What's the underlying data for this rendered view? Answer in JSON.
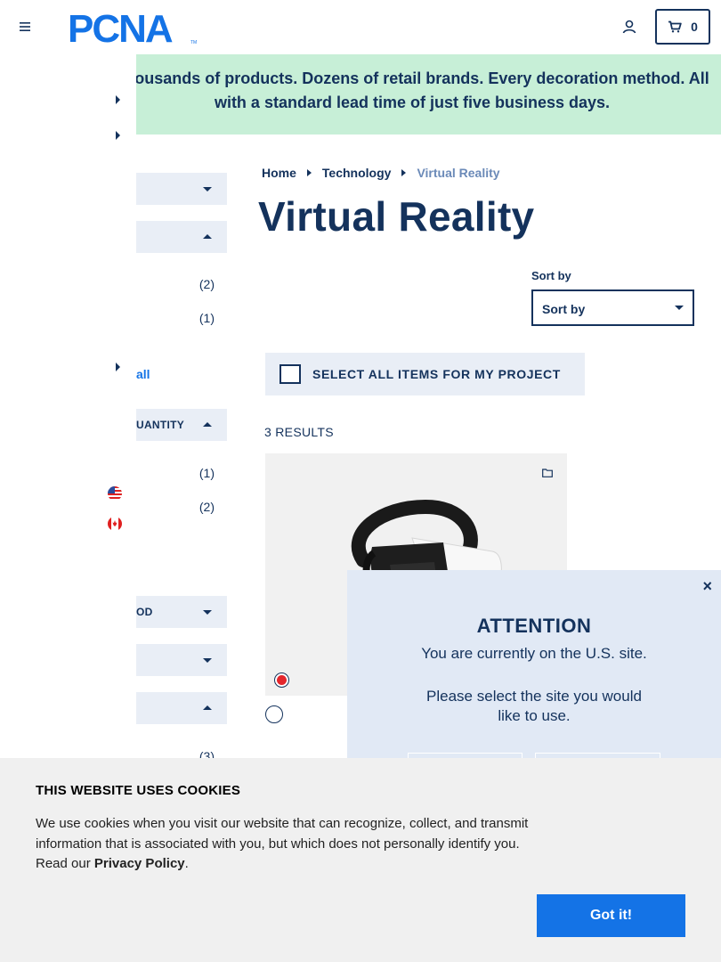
{
  "header": {
    "menu_icon": "hamburger-menu-icon",
    "logo_text": "PCNA",
    "logo_tm": "TM",
    "account_icon": "user-account-icon",
    "cart_icon": "shopping-cart-icon",
    "cart_count": "0"
  },
  "promo": {
    "text": "Thousands of products. Dozens of retail brands. Every decoration method. All with a standard lead time of just five business days."
  },
  "sidebar": {
    "counts": [
      "(2)",
      "(1)",
      "(1)",
      "(2)",
      "(3)"
    ],
    "view_all_label": "all",
    "quantity_label": "UANTITY",
    "method_label": "OD",
    "flags": [
      "us-flag-icon",
      "canada-flag-icon"
    ]
  },
  "breadcrumb": {
    "items": [
      "Home",
      "Technology",
      "Virtual Reality"
    ]
  },
  "page": {
    "title": "Virtual Reality",
    "sort_label": "Sort by",
    "sort_value": "Sort by",
    "select_all_label": "SELECT ALL ITEMS FOR MY PROJECT",
    "results": "3 RESULTS"
  },
  "product": {
    "image_icon": "vr-headset-image",
    "save_icon": "folder-icon",
    "swatches": [
      {
        "name": "red",
        "color": "#e4262c",
        "selected": true
      },
      {
        "name": "white",
        "color": "#ffffff",
        "selected": false
      }
    ]
  },
  "attention": {
    "title": "ATTENTION",
    "line1": "You are currently on the U.S. site.",
    "line2a": "Please select the site you would",
    "line2b": "like to use.",
    "close_label": "×"
  },
  "cookie": {
    "title": "THIS WEBSITE USES COOKIES",
    "text": "We use cookies when you visit our website that can recognize, collect, and transmit information that is associated with you, but which does not personally identify you. Read our",
    "privacy_link": "Privacy Policy",
    "period": ".",
    "button": "Got it!"
  },
  "colors": {
    "navy": "#14325c",
    "promo_bg": "#c7efd7",
    "accent_blue": "#1473e6",
    "filter_bg": "#e9eef6",
    "popup_bg": "#e1e9f5"
  }
}
